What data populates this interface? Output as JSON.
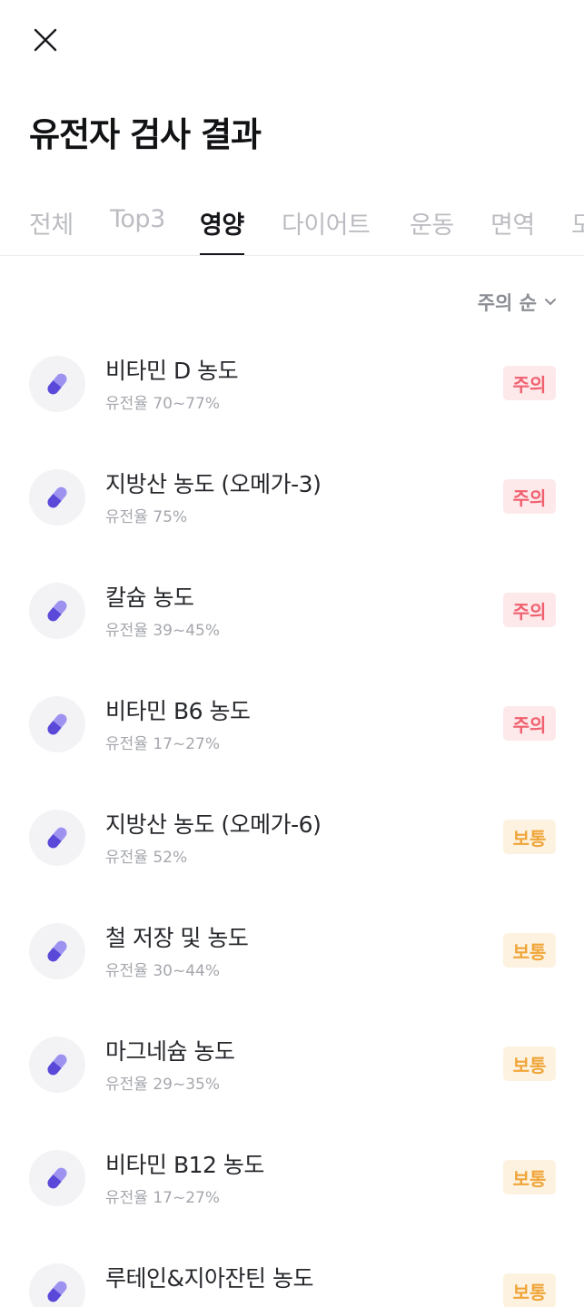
{
  "header": {
    "close_icon": "close-icon",
    "title": "유전자 검사 결과"
  },
  "tabs": [
    {
      "label": "전체",
      "active": false
    },
    {
      "label": "Top3",
      "active": false
    },
    {
      "label": "영양",
      "active": true
    },
    {
      "label": "다이어트",
      "active": false
    },
    {
      "label": "운동",
      "active": false
    },
    {
      "label": "면역",
      "active": false
    },
    {
      "label": "모",
      "active": false
    }
  ],
  "sort": {
    "label": "주의 순",
    "icon": "chevron-down-icon"
  },
  "colors": {
    "accent_pill": "#6c5ce7",
    "warn_text": "#f0606e",
    "warn_bg": "#fde8ea",
    "normal_text": "#f0a539",
    "normal_bg": "#fdf2e0"
  },
  "items": [
    {
      "name": "비타민 D 농도",
      "heritability": "유전율 70~77%",
      "status": "주의",
      "level": "warn",
      "icon": "pill-icon"
    },
    {
      "name": "지방산 농도 (오메가-3)",
      "heritability": "유전율 75%",
      "status": "주의",
      "level": "warn",
      "icon": "pill-icon"
    },
    {
      "name": "칼슘 농도",
      "heritability": "유전율 39~45%",
      "status": "주의",
      "level": "warn",
      "icon": "pill-icon"
    },
    {
      "name": "비타민 B6 농도",
      "heritability": "유전율 17~27%",
      "status": "주의",
      "level": "warn",
      "icon": "pill-icon"
    },
    {
      "name": "지방산 농도 (오메가-6)",
      "heritability": "유전율 52%",
      "status": "보통",
      "level": "normal",
      "icon": "pill-icon"
    },
    {
      "name": "철 저장 및 농도",
      "heritability": "유전율 30~44%",
      "status": "보통",
      "level": "normal",
      "icon": "pill-icon"
    },
    {
      "name": "마그네슘 농도",
      "heritability": "유전율 29~35%",
      "status": "보통",
      "level": "normal",
      "icon": "pill-icon"
    },
    {
      "name": "비타민 B12 농도",
      "heritability": "유전율 17~27%",
      "status": "보통",
      "level": "normal",
      "icon": "pill-icon"
    },
    {
      "name": "루테인&지아잔틴 농도",
      "heritability": "",
      "status": "보통",
      "level": "normal",
      "icon": "pill-icon"
    }
  ]
}
